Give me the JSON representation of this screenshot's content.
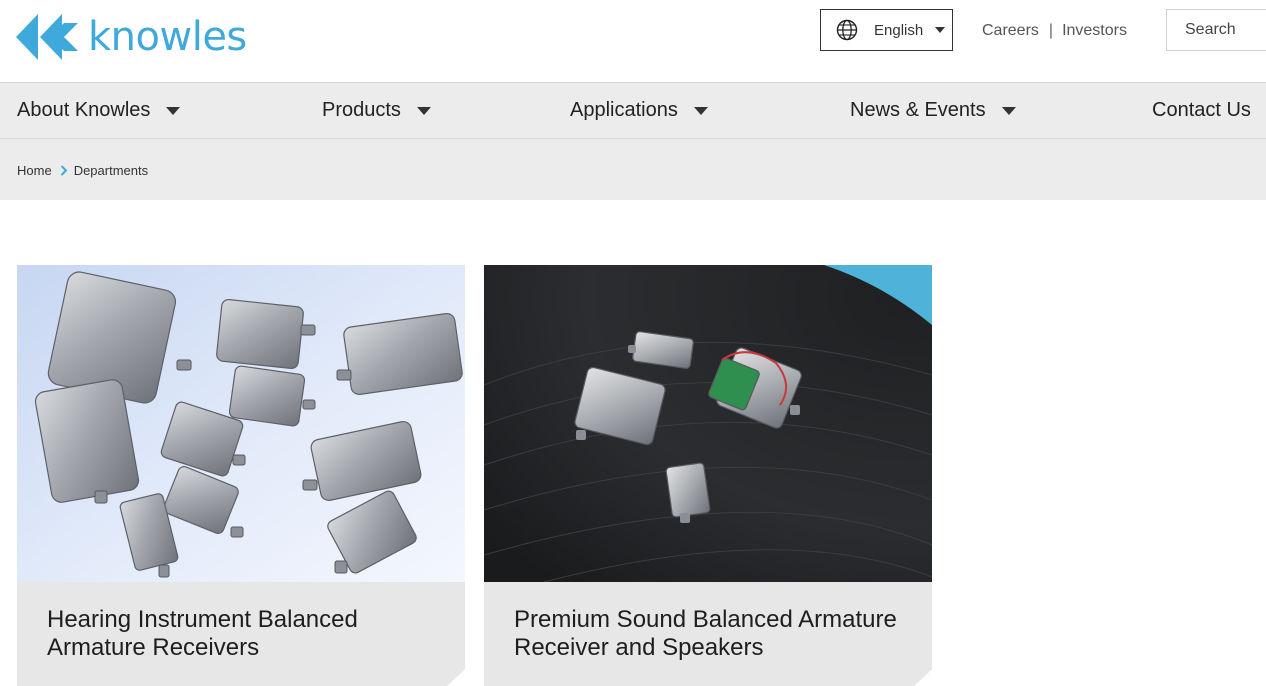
{
  "header": {
    "logo_text": "knowles",
    "language": {
      "label": "English",
      "icon": "globe-icon"
    },
    "links": [
      "Careers",
      "Investors"
    ],
    "search_label": "Search",
    "colors": {
      "brand": "#3fa9db",
      "nav_bg": "#ececec"
    }
  },
  "nav": {
    "items": [
      {
        "label": "About Knowles",
        "has_dropdown": true
      },
      {
        "label": "Products",
        "has_dropdown": true
      },
      {
        "label": "Applications",
        "has_dropdown": true
      },
      {
        "label": "News & Events",
        "has_dropdown": true
      },
      {
        "label": "Contact Us",
        "has_dropdown": false
      }
    ]
  },
  "breadcrumb": {
    "items": [
      "Home",
      "Departments"
    ]
  },
  "cards": [
    {
      "title": "Hearing Instrument Balanced Armature Receivers"
    },
    {
      "title": "Premium Sound Balanced Armature Receiver and Speakers"
    }
  ]
}
